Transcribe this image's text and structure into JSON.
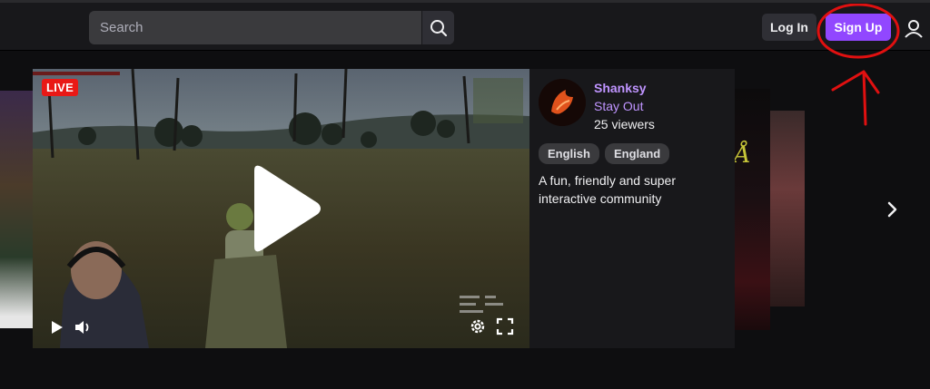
{
  "header": {
    "search": {
      "placeholder": "Search"
    },
    "login_label": "Log In",
    "signup_label": "Sign Up"
  },
  "featured": {
    "live_label": "LIVE",
    "channel": "Shanksy",
    "game": "Stay Out",
    "viewers": "25 viewers",
    "tags": [
      "English",
      "England"
    ],
    "description": "A fun, friendly and super interactive community"
  },
  "colors": {
    "brand": "#9147ff",
    "live": "#e91916",
    "link": "#bf94ff",
    "annotation": "#e01010"
  },
  "icons": {
    "search": "search-icon",
    "user": "user-icon",
    "play": "play-icon",
    "volume": "volume-icon",
    "settings": "gear-icon",
    "fullscreen": "fullscreen-icon",
    "next": "chevron-right-icon"
  }
}
